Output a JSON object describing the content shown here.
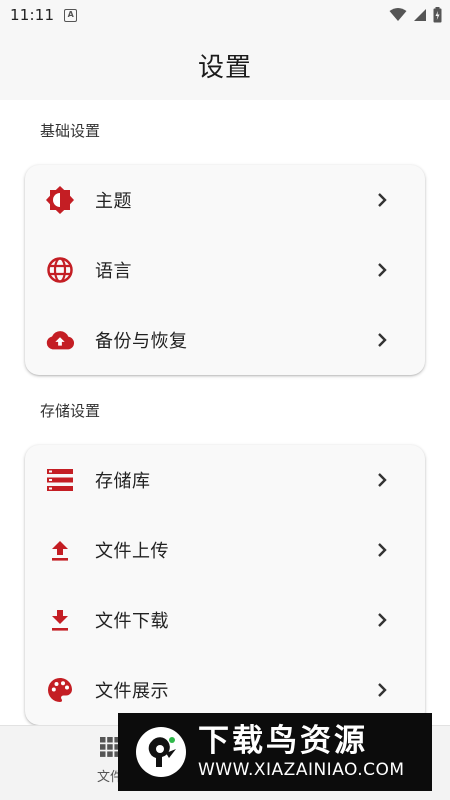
{
  "status_bar": {
    "time": "11:11",
    "notification_icon": "A"
  },
  "app_bar": {
    "title": "设置"
  },
  "sections": [
    {
      "label": "基础设置",
      "items": [
        {
          "label": "主题",
          "icon": "theme-icon"
        },
        {
          "label": "语言",
          "icon": "globe-icon"
        },
        {
          "label": "备份与恢复",
          "icon": "cloud-upload-icon"
        }
      ]
    },
    {
      "label": "存储设置",
      "items": [
        {
          "label": "存储库",
          "icon": "storage-list-icon"
        },
        {
          "label": "文件上传",
          "icon": "upload-icon"
        },
        {
          "label": "文件下载",
          "icon": "download-icon"
        },
        {
          "label": "文件展示",
          "icon": "palette-icon"
        }
      ]
    }
  ],
  "bottom_nav": {
    "item_label": "文件"
  },
  "watermark": {
    "title": "下载鸟资源",
    "url": "WWW.XIAZAINIAO.COM"
  },
  "colors": {
    "accent": "#c41e24",
    "background": "#f7f7f7",
    "card": "#f9f9f9"
  }
}
